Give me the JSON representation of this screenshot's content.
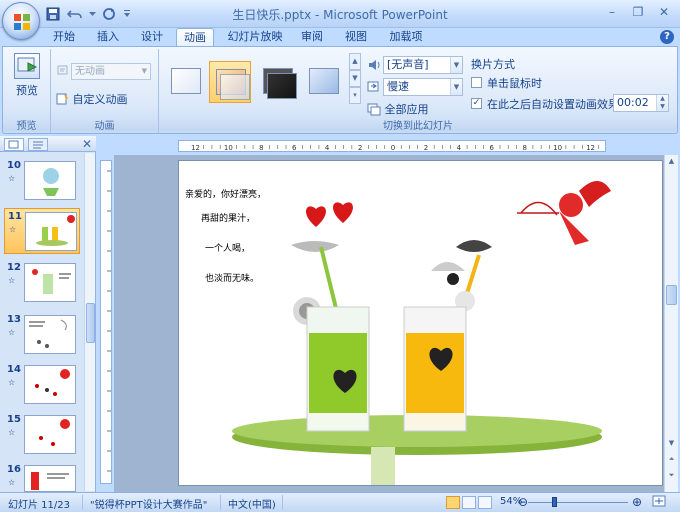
{
  "window": {
    "title": "生日快乐.pptx - Microsoft PowerPoint",
    "minimize": "–",
    "restore": "❐",
    "close": "✕"
  },
  "tabs": [
    {
      "label": "开始"
    },
    {
      "label": "插入"
    },
    {
      "label": "设计"
    },
    {
      "label": "动画",
      "active": true
    },
    {
      "label": "幻灯片放映"
    },
    {
      "label": "审阅"
    },
    {
      "label": "视图"
    },
    {
      "label": "加载项"
    }
  ],
  "help": "?",
  "ribbon": {
    "preview": {
      "button_label": "预览",
      "group_label": "预览"
    },
    "animation": {
      "select_value": "无动画",
      "custom_label": "自定义动画",
      "group_label": "动画"
    },
    "transition": {
      "sound_value": "[无声音]",
      "speed_value": "慢速",
      "apply_all_label": "全部应用",
      "group_label": "切换到此幻灯片",
      "advance_title": "换片方式",
      "on_click_label": "单击鼠标时",
      "on_click_checked": false,
      "auto_label": "在此之后自动设置动画效果:",
      "auto_checked": true,
      "auto_time": "00:02"
    }
  },
  "slide_pane": {
    "items": [
      {
        "number": "10",
        "anim": "☆"
      },
      {
        "number": "11",
        "anim": "☆",
        "selected": true
      },
      {
        "number": "12",
        "anim": "☆"
      },
      {
        "number": "13",
        "anim": "☆"
      },
      {
        "number": "14",
        "anim": "☆"
      },
      {
        "number": "15",
        "anim": "☆"
      },
      {
        "number": "16",
        "anim": "☆"
      }
    ]
  },
  "ruler": {
    "labels": [
      "12",
      "10",
      "8",
      "6",
      "4",
      "2",
      "0",
      "2",
      "4",
      "6",
      "8",
      "10",
      "12"
    ]
  },
  "slide": {
    "lines": [
      "亲爱的，你好漂亮，",
      "再甜的果汁，",
      "一个人喝，",
      "也淡而无味。"
    ]
  },
  "status": {
    "slide_info": "幻灯片 11/23",
    "theme": "\"锐得杯PPT设计大赛作品\"",
    "language": "中文(中国)",
    "zoom": "54%",
    "zoom_level": 0.54
  },
  "colors": {
    "accent": "#15428b",
    "selected": "#ffc45c"
  }
}
